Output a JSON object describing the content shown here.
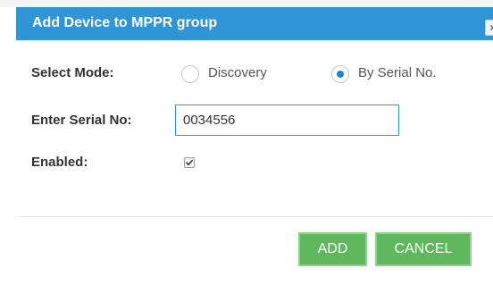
{
  "dialog": {
    "title": "Add Device to MPPR group",
    "close_glyph": "×"
  },
  "form": {
    "mode": {
      "label": "Select Mode:",
      "options": [
        {
          "label": "Discovery",
          "selected": false
        },
        {
          "label": "By Serial No.",
          "selected": true
        }
      ]
    },
    "serial": {
      "label": "Enter Serial No:",
      "value": "0034556"
    },
    "enabled": {
      "label": "Enabled:",
      "checked": true
    }
  },
  "footer": {
    "add_label": "ADD",
    "cancel_label": "CANCEL"
  },
  "colors": {
    "titlebar": "#2f95d5",
    "button": "#5fb85c",
    "radio_selected": "#1a86d6"
  },
  "icons": {
    "close": "close-icon",
    "check": "checkmark-icon"
  }
}
